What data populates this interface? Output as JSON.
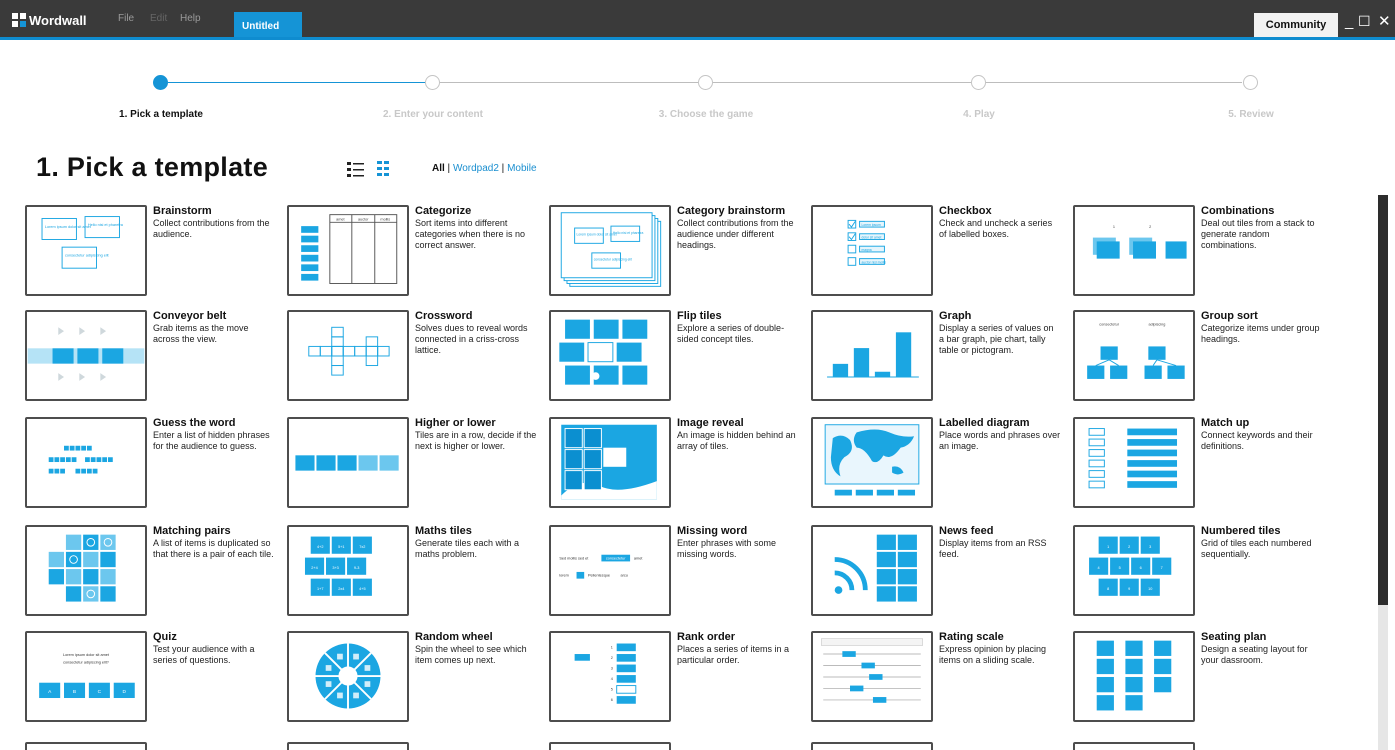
{
  "app": {
    "logo_text": "Wordwall",
    "menu": [
      "File",
      "Edit",
      "Help"
    ],
    "tab": "Untitled",
    "community_label": "Community",
    "accent_color": "#1594d6"
  },
  "stepper": {
    "steps": [
      "1. Pick a template",
      "2. Enter your content",
      "3. Choose the game",
      "4. Play",
      "5. Review"
    ],
    "active_index": 0
  },
  "page": {
    "title": "1.  Pick a template",
    "filter_all": "All",
    "filter_sep": " | ",
    "filter_wordpad": "Wordpad2",
    "filter_mobile": "Mobile"
  },
  "templates": [
    {
      "title": "Brainstorm",
      "desc": "Collect contributions from the audience.",
      "icon": "brainstorm-thumbnail",
      "thumb": {
        "texts": [
          "Lorem ipsum dolor sit amet",
          "Hello nisi et pharetra",
          "consectetur adipiscing elit"
        ]
      }
    },
    {
      "title": "Categorize",
      "desc": "Sort items into different categories when there is no correct answer.",
      "icon": "categorize-thumbnail",
      "thumb": {
        "texts": [
          "amet",
          "auctor",
          "mollis"
        ]
      }
    },
    {
      "title": "Category brainstorm",
      "desc": "Collect contributions from the audience under different headings.",
      "icon": "category-brainstorm-thumbnail",
      "thumb": {
        "texts": [
          "Lorem ipsum dolor sit amet",
          "Hello nisi et pharetra",
          "consectetur adipiscing elit"
        ]
      }
    },
    {
      "title": "Checkbox",
      "desc": "Check and uncheck a series of labelled boxes.",
      "icon": "checkbox-thumbnail",
      "thumb": {
        "texts": [
          "Lorem ipsum",
          "dolor sit amet",
          "magna",
          "auctor nisl mollis"
        ]
      }
    },
    {
      "title": "Combinations",
      "desc": "Deal out tiles from a stack to generate random combinations.",
      "icon": "combinations-thumbnail",
      "thumb": {
        "texts": [
          "1",
          "2"
        ]
      }
    },
    {
      "title": "Conveyor belt",
      "desc": "Grab items as the move across the view.",
      "icon": "conveyor-belt-thumbnail",
      "thumb": {}
    },
    {
      "title": "Crossword",
      "desc": "Solves dues to reveal words connected in a criss-cross lattice.",
      "icon": "crossword-thumbnail",
      "thumb": {}
    },
    {
      "title": "Flip tiles",
      "desc": "Explore a series of double-sided concept tiles.",
      "icon": "flip-tiles-thumbnail",
      "thumb": {}
    },
    {
      "title": "Graph",
      "desc": "Display a series of values on a bar graph, pie chart, tally table or pictogram.",
      "icon": "graph-thumbnail",
      "thumb": {
        "bars": [
          0.25,
          0.55,
          0.1,
          0.85
        ]
      }
    },
    {
      "title": "Group sort",
      "desc": "Categorize items under group headings.",
      "icon": "group-sort-thumbnail",
      "thumb": {
        "texts": [
          "consectetur",
          "adipiscing"
        ]
      }
    },
    {
      "title": "Guess the word",
      "desc": "Enter a list of hidden phrases for the audience to guess.",
      "icon": "guess-the-word-thumbnail",
      "thumb": {}
    },
    {
      "title": "Higher or lower",
      "desc": "Tiles are in a row, decide if the next is higher or lower.",
      "icon": "higher-or-lower-thumbnail",
      "thumb": {}
    },
    {
      "title": "Image reveal",
      "desc": "An image is hidden behind an array of tiles.",
      "icon": "image-reveal-thumbnail",
      "thumb": {}
    },
    {
      "title": "Labelled diagram",
      "desc": "Place words and phrases over an image.",
      "icon": "labelled-diagram-thumbnail",
      "thumb": {}
    },
    {
      "title": "Match up",
      "desc": "Connect keywords and their definitions.",
      "icon": "match-up-thumbnail",
      "thumb": {}
    },
    {
      "title": "Matching pairs",
      "desc": "A list of items is duplicated so that there is a pair of each tile.",
      "icon": "matching-pairs-thumbnail",
      "thumb": {}
    },
    {
      "title": "Maths tiles",
      "desc": "Generate tiles each with a maths problem.",
      "icon": "maths-tiles-thumbnail",
      "thumb": {
        "texts": [
          "4+2",
          "5+1",
          "7x2",
          "2+4",
          "3+3",
          "9-3",
          "1+7",
          "2x4",
          "4+5"
        ]
      }
    },
    {
      "title": "Missing word",
      "desc": "Enter phrases with some missing words.",
      "icon": "missing-word-thumbnail",
      "thumb": {
        "texts": [
          "Sed mollis sed et",
          "consectetur",
          "amet",
          "lorem",
          "Pellentesque",
          "arcu"
        ]
      }
    },
    {
      "title": "News feed",
      "desc": "Display items from an RSS feed.",
      "icon": "news-feed-thumbnail",
      "thumb": {}
    },
    {
      "title": "Numbered tiles",
      "desc": "Grid of tiles each numbered sequentially.",
      "icon": "numbered-tiles-thumbnail",
      "thumb": {
        "texts": [
          "1",
          "2",
          "3",
          "4",
          "5",
          "6",
          "7",
          "8",
          "9",
          "10"
        ]
      }
    },
    {
      "title": "Quiz",
      "desc": "Test your audience with a series of questions.",
      "icon": "quiz-thumbnail",
      "thumb": {
        "texts": [
          "Lorem ipsum dolor sit amet",
          "consectetur adipiscing elit?",
          "A",
          "B",
          "C",
          "D"
        ]
      }
    },
    {
      "title": "Random wheel",
      "desc": "Spin the wheel to see which item comes up next.",
      "icon": "random-wheel-thumbnail",
      "thumb": {}
    },
    {
      "title": "Rank order",
      "desc": "Places a series of items in a particular order.",
      "icon": "rank-order-thumbnail",
      "thumb": {
        "texts": [
          "1",
          "2",
          "3",
          "4",
          "5",
          "6"
        ]
      }
    },
    {
      "title": "Rating scale",
      "desc": "Express opinion by placing items on a sliding scale.",
      "icon": "rating-scale-thumbnail",
      "thumb": {}
    },
    {
      "title": "Seating plan",
      "desc": "Design a seating layout for your dassroom.",
      "icon": "seating-plan-thumbnail",
      "thumb": {}
    }
  ]
}
